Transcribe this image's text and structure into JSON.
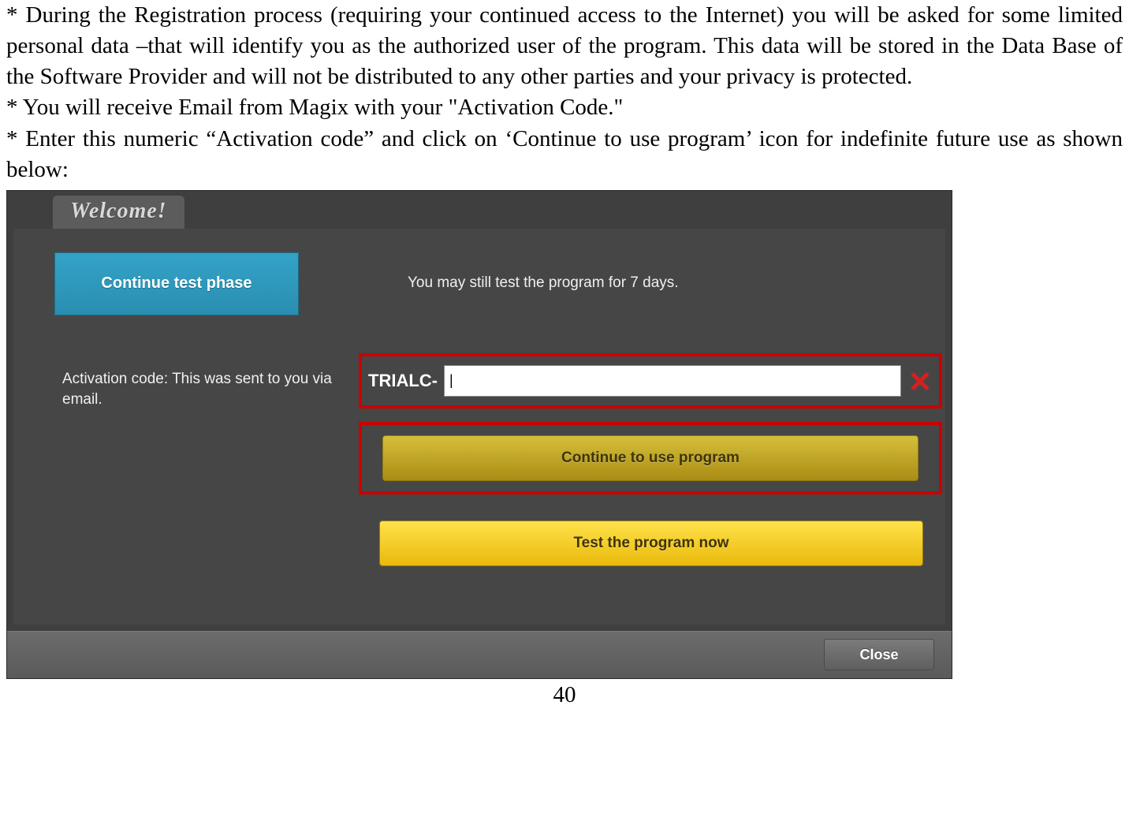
{
  "doc": {
    "bullet1": "* During the Registration process (requiring your continued access to the Internet) you will be asked for some limited personal data –that will identify you as the authorized user of the program. This data will be stored in the Data Base of the Software Provider and will not be distributed to any other parties and your privacy is protected.",
    "bullet2": "* You will receive Email from Magix with your \"Activation Code.\"",
    "bullet3": "* Enter this numeric “Activation code” and click on ‘Continue to use program’ icon for indefinite future use as shown below:"
  },
  "dialog": {
    "welcome_tab": "Welcome!",
    "continue_test_phase": "Continue test phase",
    "test_days_info": "You may still test the program for 7 days.",
    "activation_info": "Activation code: This was sent to you via email.",
    "trialc_prefix": "TRIALC-",
    "activation_input_value": "|",
    "continue_use_label": "Continue to use program",
    "test_now_label": "Test the program now",
    "close_label": "Close"
  },
  "page_number": "40"
}
